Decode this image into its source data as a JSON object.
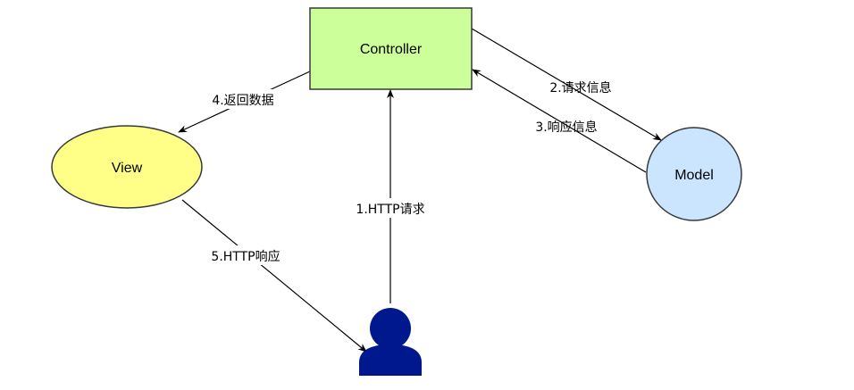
{
  "nodes": {
    "controller": {
      "label": "Controller",
      "fill": "#ccff99",
      "stroke": "#36393d"
    },
    "view": {
      "label": "View",
      "fill": "#ffff88",
      "stroke": "#36393d"
    },
    "model": {
      "label": "Model",
      "fill": "#cce5ff",
      "stroke": "#36393d"
    },
    "user": {
      "icon": "user-icon",
      "fill": "#00188d"
    }
  },
  "edges": {
    "http_request": "1.HTTP请求",
    "request_info": "2.请求信息",
    "response_info": "3.响应信息",
    "return_data": "4.返回数据",
    "http_response": "5.HTTP响应"
  }
}
